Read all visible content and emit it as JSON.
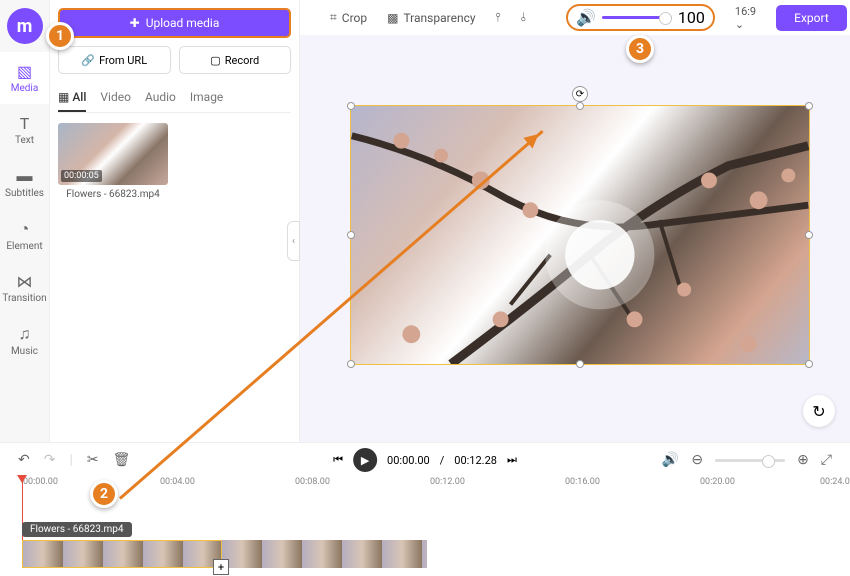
{
  "leftRail": {
    "items": [
      "Media",
      "Text",
      "Subtitles",
      "Element",
      "Transition",
      "Music"
    ]
  },
  "mediaPanel": {
    "uploadLabel": "Upload media",
    "fromUrlLabel": "From URL",
    "recordLabel": "Record",
    "tabs": {
      "all": "All",
      "video": "Video",
      "audio": "Audio",
      "image": "Image"
    },
    "thumb": {
      "duration": "00:00:05",
      "name": "Flowers - 66823.mp4"
    }
  },
  "toolbar": {
    "crop": "Crop",
    "transparency": "Transparency",
    "volume": "100",
    "aspect": "16:9",
    "export": "Export"
  },
  "playback": {
    "current": "00:00.00",
    "total": "00:12.28"
  },
  "ruler": {
    "t0": "00:00.00",
    "t1": "00:04.00",
    "t2": "00:08.00",
    "t3": "00:12.00",
    "t4": "00:16.00",
    "t5": "00:20.00",
    "t6": "00:24.00"
  },
  "clip": {
    "name": "Flowers - 66823.mp4"
  },
  "callouts": {
    "c1": "1",
    "c2": "2",
    "c3": "3"
  }
}
